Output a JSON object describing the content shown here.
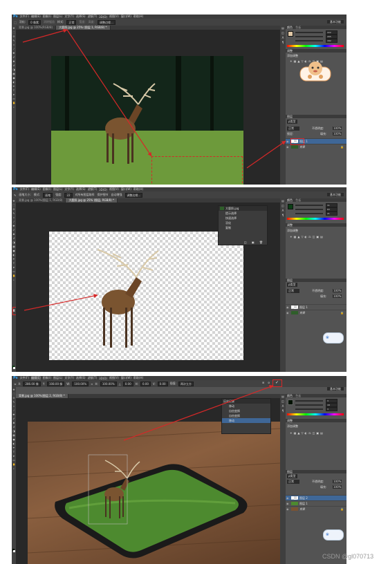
{
  "app": {
    "logo": "Ps"
  },
  "menu": [
    "文件(F)",
    "编辑(E)",
    "图像(I)",
    "图层(L)",
    "文字(Y)",
    "选择(S)",
    "滤镜(T)",
    "3D(D)",
    "视图(V)",
    "窗口(W)",
    "帮助(H)"
  ],
  "screens": [
    {
      "options": {
        "feather_label": "羽化:",
        "feather_value": "0 像素",
        "antialias": "消除锯齿",
        "style_label": "样式:",
        "style_value": "正常",
        "width_label": "宽度:",
        "height_label": "高度:",
        "refine": "调整边缘..."
      },
      "tabs": [
        "背景.jpg @ 100%(RGB/8)",
        "大鹿照.jpg @ 25% (图层 1, RGB/8) *"
      ],
      "panel_labels": {
        "color": "颜色",
        "swatches": "色板",
        "adjust": "调整",
        "add_adjust": "添加调整",
        "layers": "图层",
        "kind": "ρ类型",
        "mode": "正常",
        "opacity_label": "不透明度:",
        "opacity": "100%",
        "lock": "锁定:",
        "fill_label": "填充:",
        "fill": "100%"
      },
      "rgb": [
        "222",
        "205",
        "182"
      ],
      "layers": [
        {
          "name": "图层 1",
          "selected": true
        },
        {
          "name": "背景",
          "selected": false
        }
      ],
      "workspace": "基本功能",
      "colors": {
        "rgb_swatch": "#e0c8a6"
      }
    },
    {
      "options": {
        "size_label": "画笔大小:",
        "mode_label": "模式:",
        "mode_value": "画笔",
        "strength_label": "强度:",
        "strength_value": "22",
        "sample_all": "对所有图层取样",
        "protect_detail": "保护细节",
        "auto_enhance": "自动增强",
        "refine": "调整边缘..."
      },
      "tabs": [
        "背景.jpg @ 100%(图层 1, RGB/8)",
        "大鹿照.jpg @ 25% (图层, RGB/8) *"
      ],
      "history": {
        "doc": "大鹿照.jpg",
        "items": [
          "提示选择",
          "快速选择",
          "羽化",
          "复制"
        ]
      },
      "panel_labels": {
        "color": "颜色",
        "swatches": "色板",
        "adjust": "调整",
        "add_adjust": "添加调整",
        "layers": "图层",
        "kind": "ρ类型",
        "mode": "正常",
        "opacity_label": "不透明度:",
        "opacity": "100%",
        "fill_label": "填充:",
        "fill": "100%"
      },
      "rgb": [
        "11",
        "63",
        "21"
      ],
      "layers": [
        {
          "name": "图层 1",
          "selected": false
        },
        {
          "name": "背景",
          "selected": false
        }
      ],
      "workspace": "基本功能",
      "colors": {
        "rgb_swatch": "#0b3f15"
      }
    },
    {
      "options": {
        "x_label": "X:",
        "x_value": "286.00 像",
        "y_label": "Y:",
        "y_value": "108.00 像",
        "w_label": "W:",
        "w_value": "100.00%",
        "h_label": "H:",
        "h_value": "100.00%",
        "angle_value": "0.00",
        "hskew_label": "H:",
        "hskew_value": "0.00",
        "vskew_label": "V:",
        "vskew_value": "0.00",
        "interp_label": "插值:",
        "interp_value": "两次立方"
      },
      "tabs": [
        "背景.jpg @ 100%(图层 2, RGB/8) *"
      ],
      "history": {
        "doc": "历史记录",
        "items": [
          "移动",
          "自由变换",
          "自由变换",
          "移动"
        ]
      },
      "panel_labels": {
        "color": "颜色",
        "swatches": "色板",
        "adjust": "调整",
        "add_adjust": "添加调整",
        "layers": "图层",
        "kind": "ρ类型",
        "mode": "正常",
        "opacity_label": "不透明度:",
        "opacity": "100%",
        "fill_label": "填充:",
        "fill": "100%"
      },
      "rgb": [
        "3",
        "18",
        "3"
      ],
      "layers": [
        {
          "name": "图层 2",
          "selected": true
        },
        {
          "name": "图层 1",
          "selected": false
        },
        {
          "name": "背景",
          "selected": false
        }
      ],
      "workspace": "基本功能",
      "colors": {
        "rgb_swatch": "#031203"
      }
    }
  ],
  "watermark": "CSDN @gl070713"
}
